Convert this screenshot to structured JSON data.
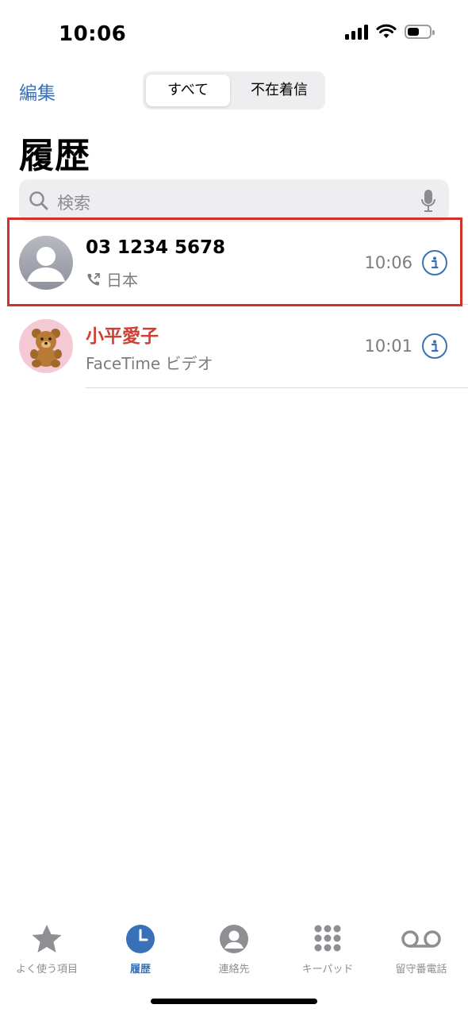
{
  "status": {
    "time": "10:06"
  },
  "nav": {
    "edit_label": "編集",
    "segments": [
      {
        "label": "すべて",
        "selected": true
      },
      {
        "label": "不在着信",
        "selected": false
      }
    ],
    "title": "履歴"
  },
  "search": {
    "placeholder": "検索",
    "icon": "search-icon",
    "mic_icon": "microphone-icon"
  },
  "calls": [
    {
      "name": "03 1234 5678",
      "type_icon": "outgoing-call-icon",
      "detail": "日本",
      "time": "10:06",
      "name_color": "#000000",
      "highlighted": true
    },
    {
      "name": "小平愛子",
      "detail": "FaceTime ビデオ",
      "time": "10:01",
      "name_color": "#cf3f35",
      "avatar": "teddy-bear",
      "highlighted": false
    }
  ],
  "tab_bar": {
    "tabs": [
      {
        "label": "よく使う項目",
        "icon": "star-icon",
        "active": false
      },
      {
        "label": "履歴",
        "icon": "clock-icon",
        "active": true
      },
      {
        "label": "連絡先",
        "icon": "contact-icon",
        "active": false
      },
      {
        "label": "キーパッド",
        "icon": "keypad-icon",
        "active": false
      },
      {
        "label": "留守番電話",
        "icon": "voicemail-icon",
        "active": false
      }
    ]
  },
  "colors": {
    "accent": "#3871b8",
    "missed": "#cf3f35",
    "highlight_border": "#d2312b"
  }
}
